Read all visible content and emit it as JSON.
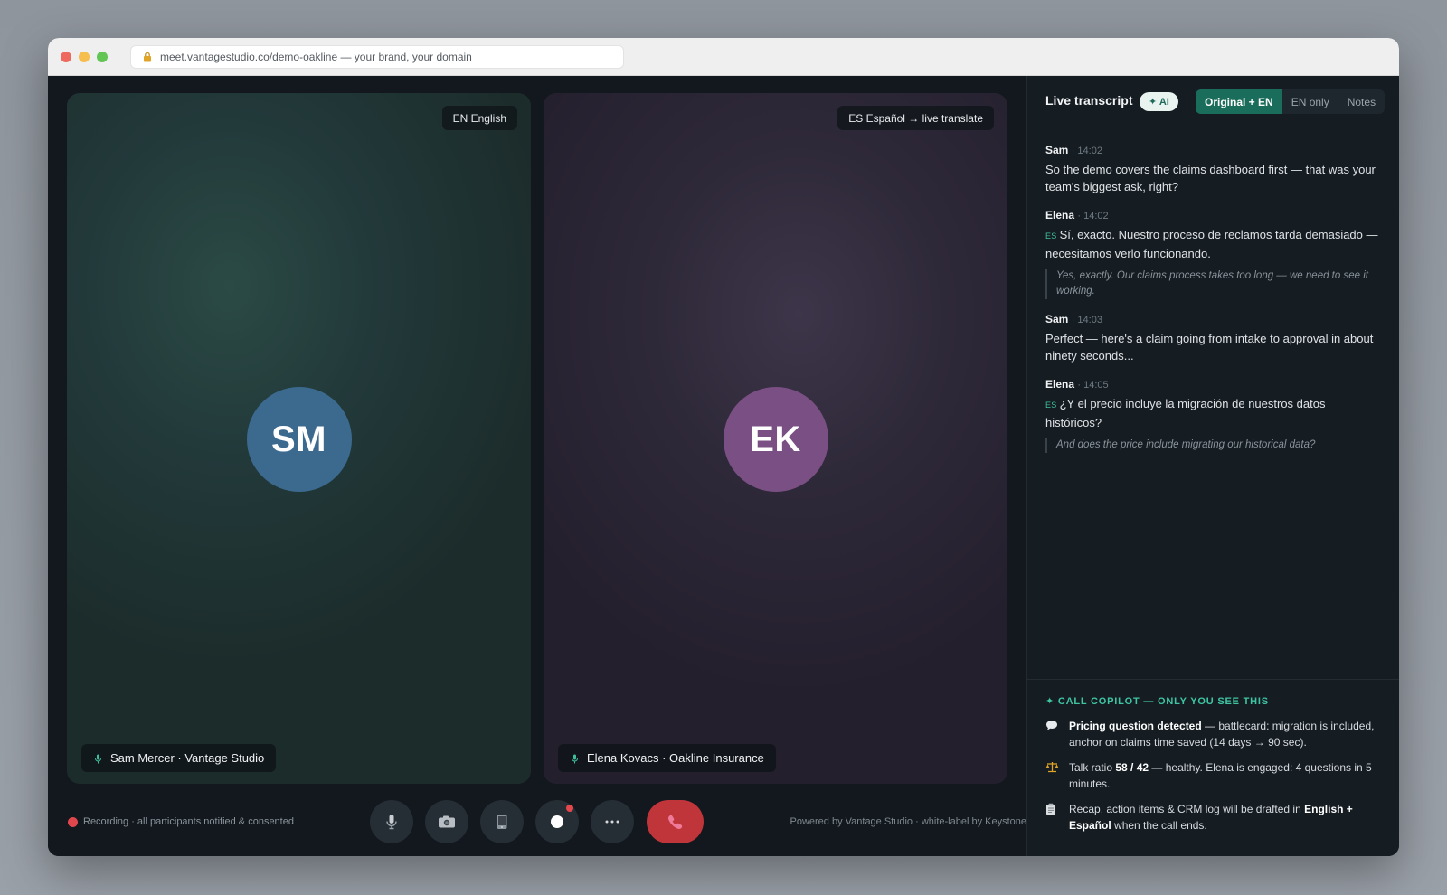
{
  "browser": {
    "url": "meet.vantagestudio.co/demo-oakline — your brand, your domain"
  },
  "tiles": [
    {
      "initials": "SM",
      "lang_badge": "EN English",
      "name": "Sam Mercer · Vantage Studio",
      "avatar_color": "#3c6a8f"
    },
    {
      "initials": "EK",
      "lang_badge": "ES Español → live translate",
      "name": "Elena Kovacs · Oakline Insurance",
      "avatar_color": "#7a4f83"
    }
  ],
  "controls": {
    "icons": [
      "microphone-icon",
      "camera-icon",
      "screen-share-icon",
      "record-icon",
      "more-icon",
      "end-call-icon"
    ]
  },
  "footer": {
    "recording": "Recording · all participants notified & consented",
    "powered": "Powered by Vantage Studio · white-label by Keystone"
  },
  "sidebar": {
    "title": "Live transcript",
    "ai_badge": "✦ AI",
    "tabs": [
      {
        "label": "Original + EN",
        "active": true
      },
      {
        "label": "EN only",
        "active": false
      },
      {
        "label": "Notes",
        "active": false
      }
    ],
    "messages": [
      {
        "speaker": "Sam",
        "time": "· 14:02",
        "text": "So the demo covers the claims dashboard first — that was your team's biggest ask, right?"
      },
      {
        "speaker": "Elena",
        "time": "· 14:02",
        "lang": "ES",
        "text": "Sí, exacto. Nuestro proceso de reclamos tarda demasiado — necesitamos verlo funcionando.",
        "translation": "Yes, exactly. Our claims process takes too long — we need to see it working."
      },
      {
        "speaker": "Sam",
        "time": "· 14:03",
        "text": "Perfect — here's a claim going from intake to approval in about ninety seconds..."
      },
      {
        "speaker": "Elena",
        "time": "· 14:05",
        "lang": "ES",
        "text": "¿Y el precio incluye la migración de nuestros datos históricos?",
        "translation": "And does the price include migrating our historical data?"
      }
    ],
    "copilot": {
      "title": "✦ CALL COPILOT — ONLY YOU SEE THIS",
      "items": [
        {
          "icon": "speech-bubble-icon",
          "bold": "Pricing question detected",
          "text": " — battlecard: migration is included, anchor on claims time saved (14 days → 90 sec)."
        },
        {
          "icon": "balance-scale-icon",
          "pre": "Talk ratio ",
          "bold": "58 / 42",
          "text": " — healthy. Elena is engaged: 4 questions in 5 minutes."
        },
        {
          "icon": "clipboard-icon",
          "pre": "Recap, action items & CRM log will be drafted in ",
          "bold": "English + Español",
          "text": " when the call ends."
        }
      ]
    }
  }
}
